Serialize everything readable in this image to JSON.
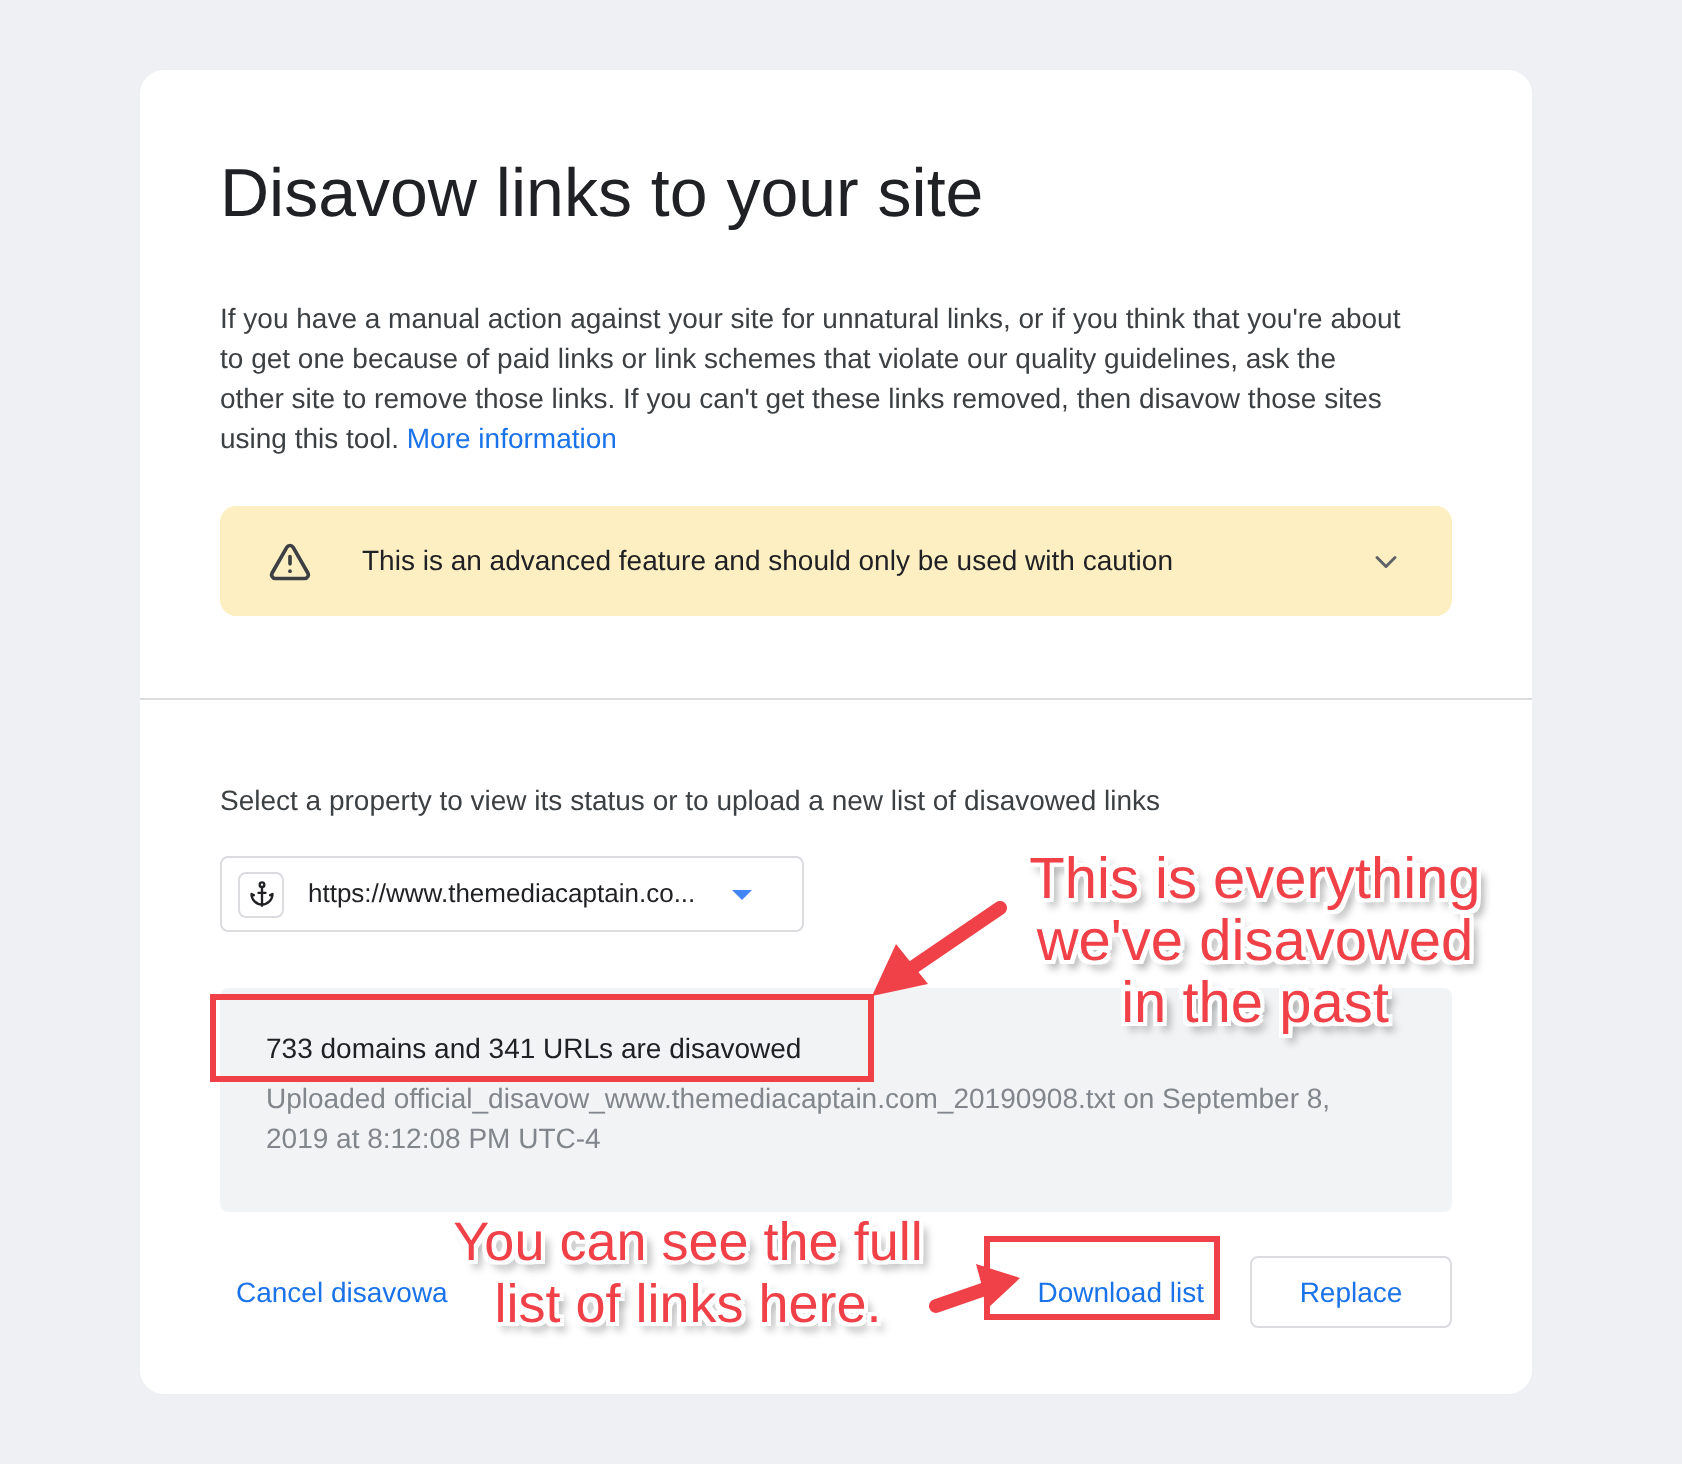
{
  "card": {
    "title": "Disavow links to your site",
    "intro": "If you have a manual action against your site for unnatural links, or if you think that you're about to get one because of paid links or link schemes that violate our quality guidelines, ask the other site to remove those links. If you can't get these links removed, then disavow those sites using this tool.",
    "intro_link": "More information",
    "warning": {
      "text": "This is an advanced feature and should only be used with caution",
      "expanded": false
    },
    "property_label": "Select a property to view its status or to upload a new list of disavowed links",
    "property_select": {
      "value": "https://www.themediacaptain.co..."
    },
    "status": {
      "summary": "733 domains and 341 URLs are disavowed",
      "detail": "Uploaded official_disavow_www.themediacaptain.com_20190908.txt on September 8, 2019 at 8:12:08 PM UTC-4"
    },
    "actions": [
      {
        "kind": "link",
        "label": "Cancel disavowa"
      },
      {
        "kind": "text",
        "label": "Download list"
      },
      {
        "kind": "outlined",
        "label": "Replace"
      }
    ]
  },
  "annotations": [
    {
      "text": "This is everything we've disavowed in the past"
    },
    {
      "text": "You can see the full list of links here."
    }
  ]
}
